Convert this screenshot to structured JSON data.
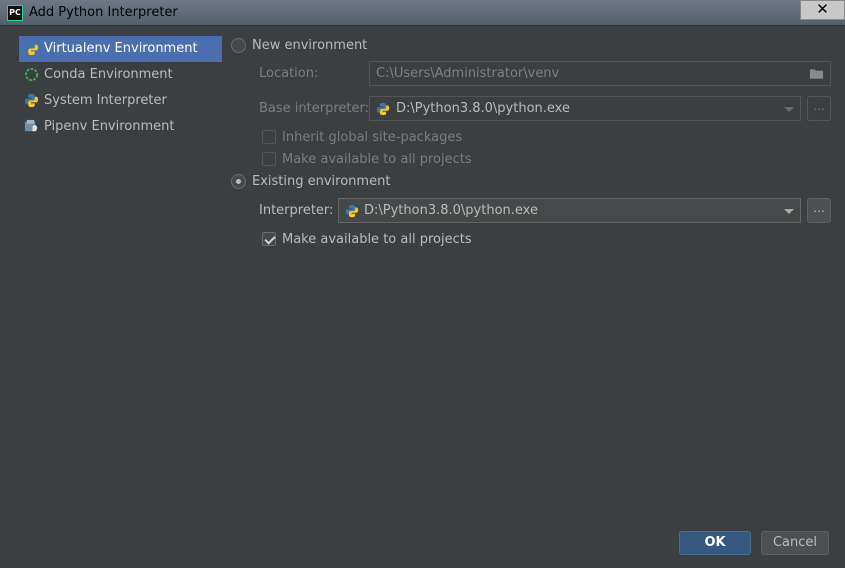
{
  "window": {
    "title": "Add Python Interpreter",
    "app_icon_text": "PC",
    "close_glyph": "✕"
  },
  "sidebar": {
    "items": [
      {
        "label": "Virtualenv Environment",
        "icon": "python-icon",
        "selected": true
      },
      {
        "label": "Conda Environment",
        "icon": "conda-icon",
        "selected": false
      },
      {
        "label": "System Interpreter",
        "icon": "python-icon",
        "selected": false
      },
      {
        "label": "Pipenv Environment",
        "icon": "pipenv-icon",
        "selected": false
      }
    ]
  },
  "new_env": {
    "radio_label": "New environment",
    "location_label": "Location:",
    "location_value": "C:\\Users\\Administrator\\venv",
    "base_label": "Base interpreter:",
    "base_value": "D:\\Python3.8.0\\python.exe",
    "inherit_label": "Inherit global site-packages",
    "make_available_label": "Make available to all projects",
    "browse_label": "..."
  },
  "existing_env": {
    "radio_label": "Existing environment",
    "interpreter_label": "Interpreter:",
    "interpreter_value": "D:\\Python3.8.0\\python.exe",
    "make_available_label": "Make available to all projects",
    "browse_label": "..."
  },
  "footer": {
    "ok_label": "OK",
    "cancel_label": "Cancel"
  },
  "colors": {
    "background": "#3c3f41",
    "selection": "#4b6eaf",
    "ok_button": "#365880"
  }
}
